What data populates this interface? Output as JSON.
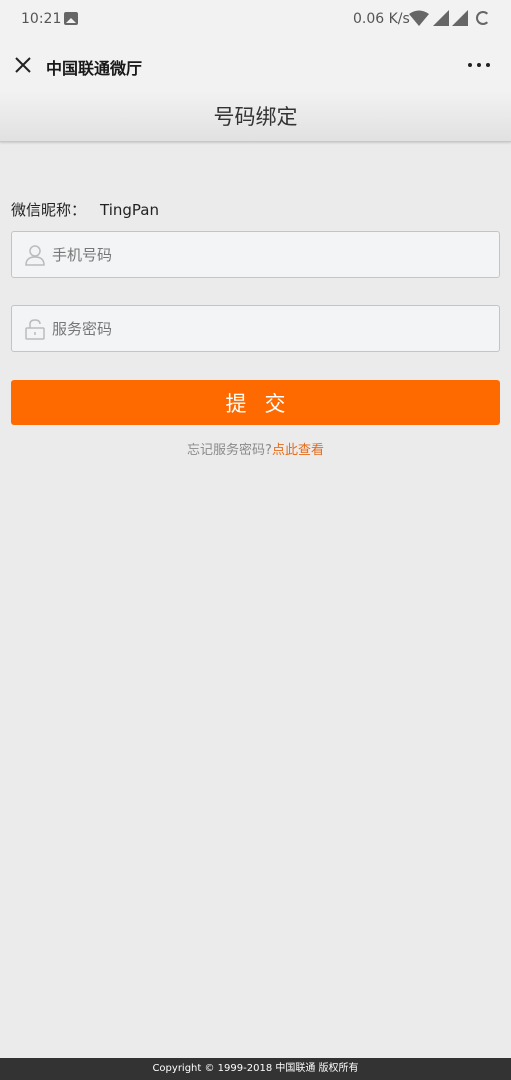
{
  "status_bar": {
    "time": "10:21",
    "net_speed": "0.06 K/s",
    "icons": [
      "image-icon",
      "wifi-icon",
      "signal-icon",
      "signal-icon",
      "loading-icon"
    ]
  },
  "app_bar": {
    "title": "中国联通微厅",
    "close_icon": "close-icon",
    "more_icon": "more-icon"
  },
  "page": {
    "heading": "号码绑定"
  },
  "form": {
    "nickname_label": "微信昵称：",
    "nickname_value": "TingPan",
    "phone_placeholder": "手机号码",
    "phone_icon": "user-icon",
    "password_placeholder": "服务密码",
    "password_icon": "lock-icon",
    "submit_label": "提交",
    "forgot_text": "忘记服务密码?",
    "forgot_link": "点此查看"
  },
  "footer": {
    "copyright": "Copyright © 1999-2018 中国联通 版权所有"
  },
  "colors": {
    "accent": "#ff6a00",
    "link": "#e86b1a",
    "background": "#ebebeb",
    "footer_bg": "#333333"
  }
}
